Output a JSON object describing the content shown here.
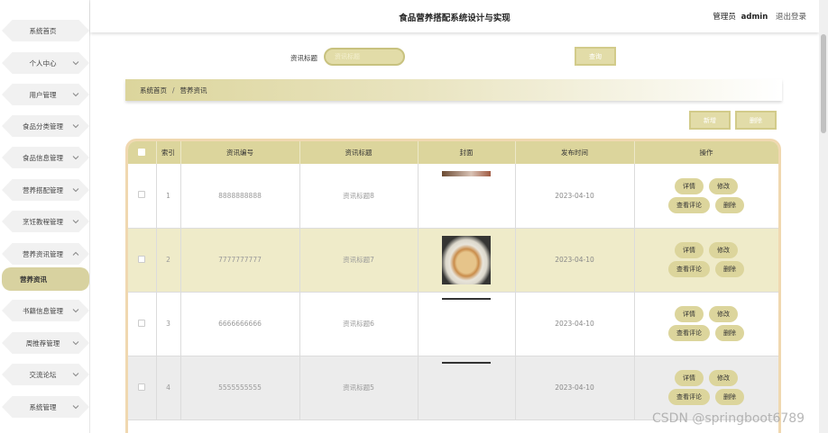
{
  "app": {
    "title": "食品营养搭配系统设计与实现"
  },
  "user": {
    "role": "管理员",
    "name": "admin",
    "logout": "退出登录"
  },
  "sidebar": {
    "items": [
      {
        "label": "系统首页",
        "has_chevron": false,
        "expanded": false,
        "active": false
      },
      {
        "label": "个人中心",
        "has_chevron": true,
        "expanded": false,
        "active": false
      },
      {
        "label": "用户管理",
        "has_chevron": true,
        "expanded": false,
        "active": false
      },
      {
        "label": "食品分类管理",
        "has_chevron": true,
        "expanded": false,
        "active": false
      },
      {
        "label": "食品信息管理",
        "has_chevron": true,
        "expanded": false,
        "active": false
      },
      {
        "label": "营养搭配管理",
        "has_chevron": true,
        "expanded": false,
        "active": false
      },
      {
        "label": "烹饪教程管理",
        "has_chevron": true,
        "expanded": false,
        "active": false
      },
      {
        "label": "营养资讯管理",
        "has_chevron": true,
        "expanded": true,
        "active": false
      },
      {
        "label": "营养资讯",
        "has_chevron": false,
        "expanded": false,
        "active": true
      },
      {
        "label": "书籍信息管理",
        "has_chevron": true,
        "expanded": false,
        "active": false
      },
      {
        "label": "周推荐管理",
        "has_chevron": true,
        "expanded": false,
        "active": false
      },
      {
        "label": "交流论坛",
        "has_chevron": true,
        "expanded": false,
        "active": false
      },
      {
        "label": "系统管理",
        "has_chevron": true,
        "expanded": false,
        "active": false
      }
    ]
  },
  "search": {
    "label": "资讯标题",
    "placeholder": "资讯标题",
    "button": "查询"
  },
  "breadcrumb": {
    "home": "系统首页",
    "separator": "/",
    "current": "营养资讯"
  },
  "actions": {
    "add": "新增",
    "delete": "删除"
  },
  "table": {
    "columns": [
      "",
      "索引",
      "资讯编号",
      "资讯标题",
      "封面",
      "发布时间",
      "操作"
    ],
    "rows": [
      {
        "index": "1",
        "code": "8888888888",
        "title": "资讯标题8",
        "cover": "cover-1",
        "date": "2023-04-10"
      },
      {
        "index": "2",
        "code": "7777777777",
        "title": "资讯标题7",
        "cover": "cover-2",
        "date": "2023-04-10"
      },
      {
        "index": "3",
        "code": "6666666666",
        "title": "资讯标题6",
        "cover": "cover-3",
        "date": "2023-04-10"
      },
      {
        "index": "4",
        "code": "5555555555",
        "title": "资讯标题5",
        "cover": "cover-4",
        "date": "2023-04-10"
      }
    ],
    "row_ops": {
      "detail": "详情",
      "edit": "修改",
      "comments": "查看评论",
      "delete": "删除"
    }
  },
  "watermark": "CSDN @springboot6789",
  "colors": {
    "accent": "#dcd59c",
    "accent_light": "#efebc9",
    "border_accent": "#f0d8b0",
    "row_grey": "#ececec"
  }
}
